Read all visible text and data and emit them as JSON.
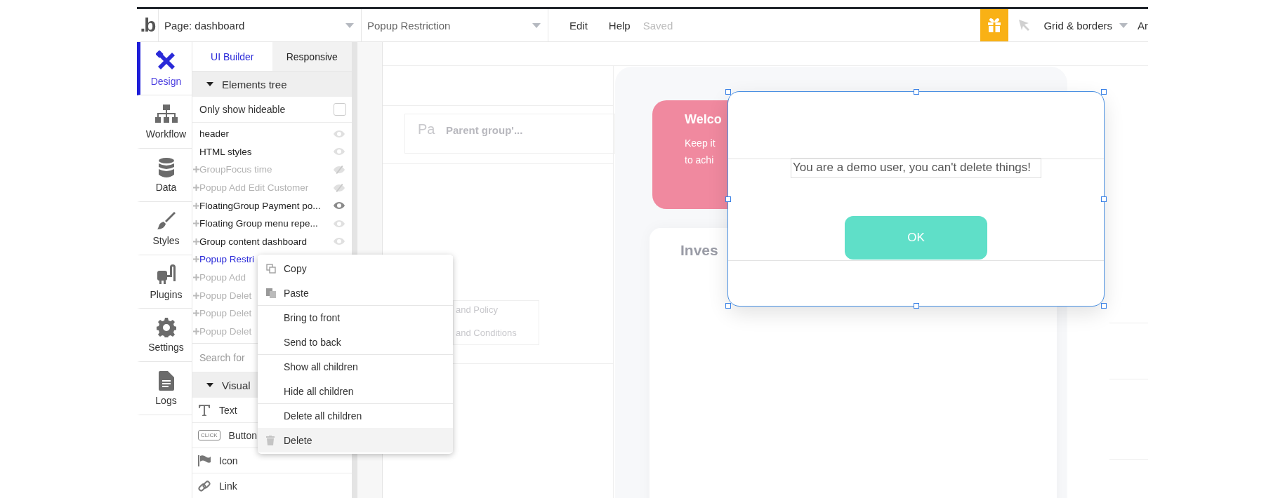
{
  "topbar": {
    "logo": ".b",
    "page_dropdown": "Page: dashboard",
    "element_dropdown": "Popup Restriction",
    "menu": [
      "Edit",
      "Help"
    ],
    "status": "Saved",
    "view_dropdown": "Grid & borders",
    "cut_item": "Ar"
  },
  "rail": [
    {
      "label": "Design",
      "kind": "design",
      "selected": true
    },
    {
      "label": "Workflow",
      "kind": "workflow",
      "selected": false
    },
    {
      "label": "Data",
      "kind": "data",
      "selected": false
    },
    {
      "label": "Styles",
      "kind": "styles",
      "selected": false
    },
    {
      "label": "Plugins",
      "kind": "plugins",
      "selected": false
    },
    {
      "label": "Settings",
      "kind": "settings",
      "selected": false
    },
    {
      "label": "Logs",
      "kind": "logs",
      "selected": false
    }
  ],
  "panel": {
    "tabs": [
      {
        "label": "UI Builder",
        "selected": true
      },
      {
        "label": "Responsive",
        "selected": false
      }
    ],
    "tree_header": "Elements tree",
    "hideable": {
      "label": "Only show hideable",
      "checked": false
    },
    "tree": [
      {
        "label": "header",
        "expandable": false,
        "hidden": false,
        "selected": false,
        "kind": "faint"
      },
      {
        "label": "HTML styles",
        "expandable": false,
        "hidden": false,
        "selected": false,
        "kind": "faint"
      },
      {
        "label": "GroupFocus time",
        "expandable": true,
        "hidden": true,
        "selected": false,
        "kind": "slashed"
      },
      {
        "label": "Popup Add Edit Customer",
        "expandable": true,
        "hidden": true,
        "selected": false,
        "kind": "slashed"
      },
      {
        "label": "FloatingGroup Payment po...",
        "expandable": true,
        "hidden": false,
        "selected": false,
        "kind": "dark"
      },
      {
        "label": "Floating Group menu repe...",
        "expandable": true,
        "hidden": false,
        "selected": false,
        "kind": "faint"
      },
      {
        "label": "Group content dashboard",
        "expandable": true,
        "hidden": false,
        "selected": false,
        "kind": "faint"
      },
      {
        "label": "Popup Restri",
        "expandable": true,
        "hidden": false,
        "selected": true
      },
      {
        "label": "Popup Add",
        "expandable": true,
        "hidden": true,
        "selected": false
      },
      {
        "label": "Popup Delet",
        "expandable": true,
        "hidden": true,
        "selected": false
      },
      {
        "label": "Popup Delet",
        "expandable": true,
        "hidden": true,
        "selected": false
      },
      {
        "label": "Popup Delet",
        "expandable": true,
        "hidden": true,
        "selected": false
      }
    ],
    "search": {
      "placeholder": "Search for"
    },
    "palette_header": "Visual",
    "palette": [
      {
        "label": "Text",
        "kind": "text"
      },
      {
        "label": "Button",
        "kind": "button",
        "badge": "CLICK"
      },
      {
        "label": "Icon",
        "kind": "flag"
      },
      {
        "label": "Link",
        "kind": "link"
      }
    ]
  },
  "context_menu": [
    {
      "label": "Copy",
      "kind": "copy",
      "divider_before": false,
      "highlighted": false
    },
    {
      "label": "Paste",
      "kind": "paste",
      "divider_before": false,
      "highlighted": false
    },
    {
      "label": "Bring to front",
      "divider_before": true,
      "highlighted": false
    },
    {
      "label": "Send to back",
      "divider_before": false,
      "highlighted": false
    },
    {
      "label": "Show all children",
      "divider_before": true,
      "highlighted": false
    },
    {
      "label": "Hide all children",
      "divider_before": false,
      "highlighted": false
    },
    {
      "label": "Delete all children",
      "divider_before": true,
      "highlighted": false
    },
    {
      "label": "Delete",
      "kind": "trash",
      "divider_before": false,
      "highlighted": true
    }
  ],
  "canvas": {
    "header_labels": [
      "Pa",
      "Parent group'..."
    ],
    "footer_links": [
      "and Policy",
      "and Conditions"
    ],
    "welcome": {
      "title": "Welco",
      "lines": [
        "Keep it",
        "to achi"
      ]
    },
    "section_title": "Inves",
    "popup": {
      "message": "You are a demo user, you can't delete things!",
      "button": "OK",
      "selected": true
    }
  }
}
